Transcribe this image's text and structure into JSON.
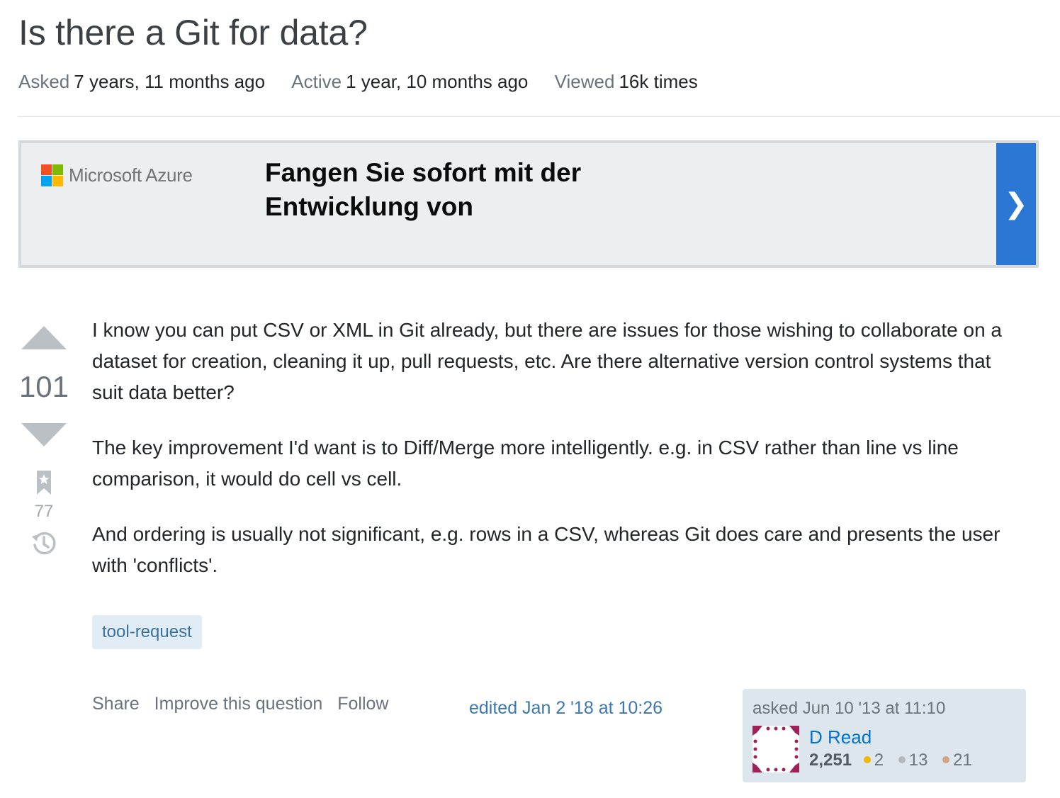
{
  "question": {
    "title": "Is there a Git for data?",
    "meta": {
      "asked_label": "Asked",
      "asked_value": "7 years, 11 months ago",
      "active_label": "Active",
      "active_value": "1 year, 10 months ago",
      "viewed_label": "Viewed",
      "viewed_value": "16k times"
    },
    "score": "101",
    "bookmark_count": "77",
    "body": [
      "I know you can put CSV or XML in Git already, but there are issues for those wishing to collaborate on a dataset for creation, cleaning it up, pull requests, etc. Are there alternative version control systems that suit data better?",
      "The key improvement I'd want is to Diff/Merge more intelligently. e.g. in CSV rather than line vs line comparison, it would do cell vs cell.",
      "And ordering is usually not significant, e.g. rows in a CSV, whereas Git does care and presents the user with 'conflicts'."
    ],
    "tags": [
      "tool-request"
    ],
    "actions": {
      "share": "Share",
      "improve": "Improve this question",
      "follow": "Follow"
    },
    "edited": "edited Jan 2 '18 at 10:26",
    "owner": {
      "asked": "asked Jun 10 '13 at 11:10",
      "name": "D Read",
      "reputation": "2,251",
      "gold": "2",
      "silver": "13",
      "bronze": "21"
    }
  },
  "ad": {
    "brand": "Microsoft Azure",
    "headline": "Fangen Sie sofort mit der Entwicklung von",
    "cta_icon": "chevron-right-icon"
  },
  "colors": {
    "brand_blue": "#2b78d4",
    "tag_bg": "#e1ecf4",
    "tag_text": "#39739d",
    "owner_card_bg": "#dde5ed"
  }
}
